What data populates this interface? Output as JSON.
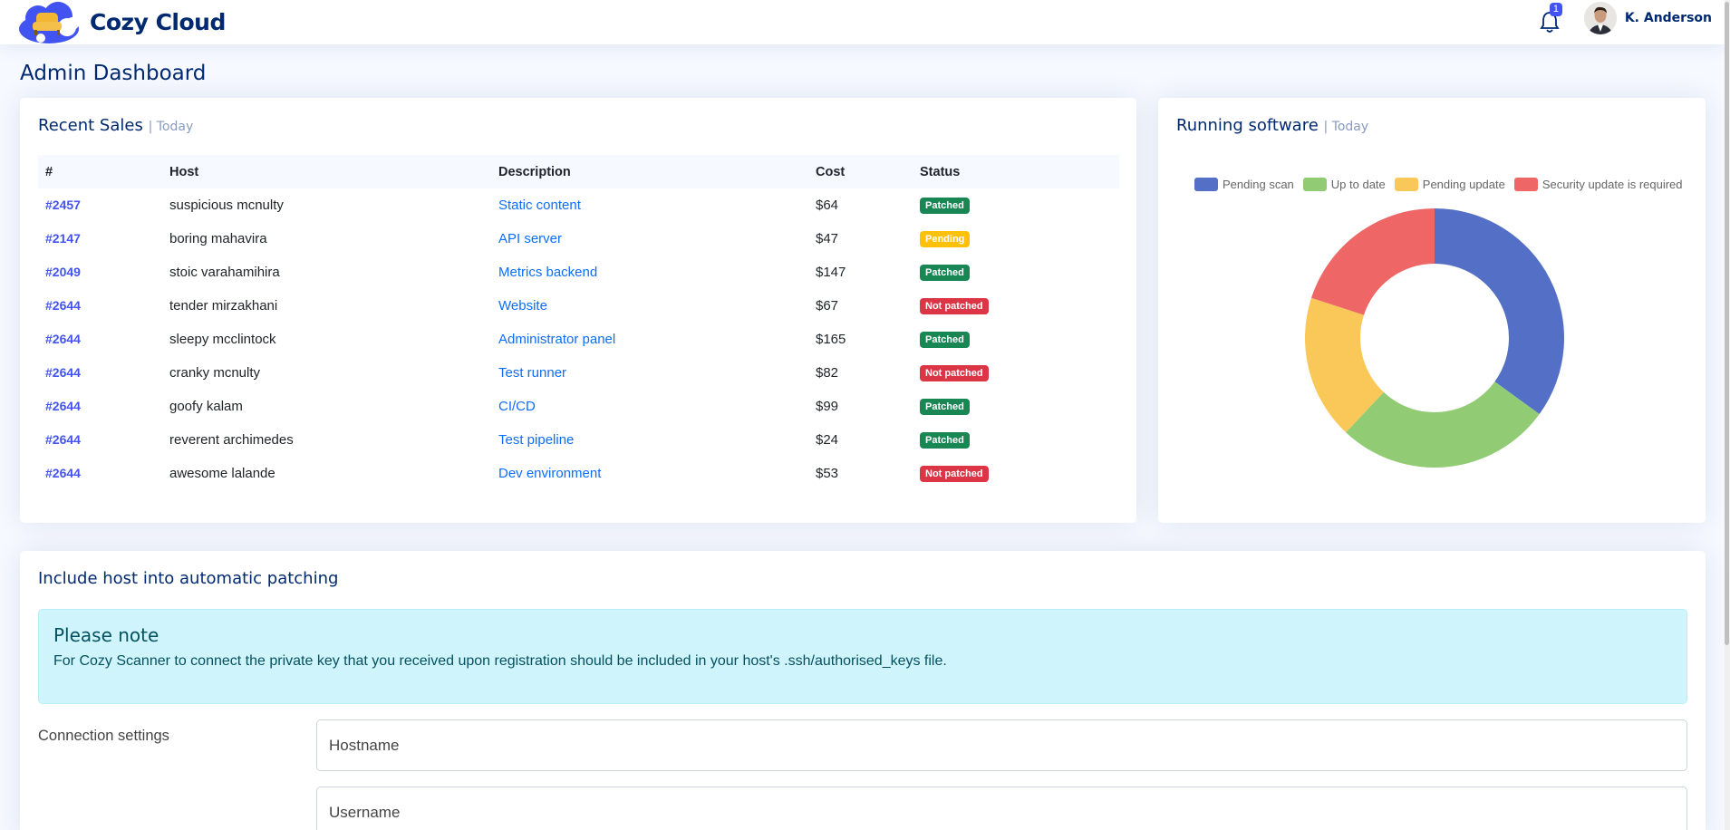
{
  "brand": {
    "name": "Cozy Cloud"
  },
  "header": {
    "notifications_count": "1",
    "user_name": "K. Anderson"
  },
  "page": {
    "title": "Admin Dashboard"
  },
  "sales": {
    "title": "Recent Sales",
    "subtitle": "| Today",
    "columns": [
      "#",
      "Host",
      "Description",
      "Cost",
      "Status"
    ],
    "rows": [
      {
        "id": "#2457",
        "host": "suspicious mcnulty",
        "description": "Static content",
        "cost": "$64",
        "status": "Patched"
      },
      {
        "id": "#2147",
        "host": "boring mahavira",
        "description": "API server",
        "cost": "$47",
        "status": "Pending"
      },
      {
        "id": "#2049",
        "host": "stoic varahamihira",
        "description": "Metrics backend",
        "cost": "$147",
        "status": "Patched"
      },
      {
        "id": "#2644",
        "host": "tender mirzakhani",
        "description": "Website",
        "cost": "$67",
        "status": "Not patched"
      },
      {
        "id": "#2644",
        "host": "sleepy mcclintock",
        "description": "Administrator panel",
        "cost": "$165",
        "status": "Patched"
      },
      {
        "id": "#2644",
        "host": "cranky mcnulty",
        "description": "Test runner",
        "cost": "$82",
        "status": "Not patched"
      },
      {
        "id": "#2644",
        "host": "goofy kalam",
        "description": "CI/CD",
        "cost": "$99",
        "status": "Patched"
      },
      {
        "id": "#2644",
        "host": "reverent archimedes",
        "description": "Test pipeline",
        "cost": "$24",
        "status": "Patched"
      },
      {
        "id": "#2644",
        "host": "awesome lalande",
        "description": "Dev environment",
        "cost": "$53",
        "status": "Not patched"
      }
    ],
    "status_colors": {
      "Patched": "#198754",
      "Pending": "#ffc107",
      "Not patched": "#dc3545"
    }
  },
  "software": {
    "title": "Running software",
    "subtitle": "| Today",
    "chart_data": {
      "type": "pie",
      "categories": [
        "Pending scan",
        "Up to date",
        "Pending update",
        "Security update is required"
      ],
      "values": [
        35,
        27,
        18,
        20
      ],
      "colors": [
        "#5470c6",
        "#91cc75",
        "#fac858",
        "#ee6666"
      ],
      "legend": "top"
    }
  },
  "patching": {
    "title": "Include host into automatic patching",
    "alert_title": "Please note",
    "alert_text": "For Cozy Scanner to connect the private key that you received upon registration should be included in your host's .ssh/authorised_keys file.",
    "connection_label": "Connection settings",
    "hostname_placeholder": "Hostname",
    "username_placeholder": "Username"
  }
}
